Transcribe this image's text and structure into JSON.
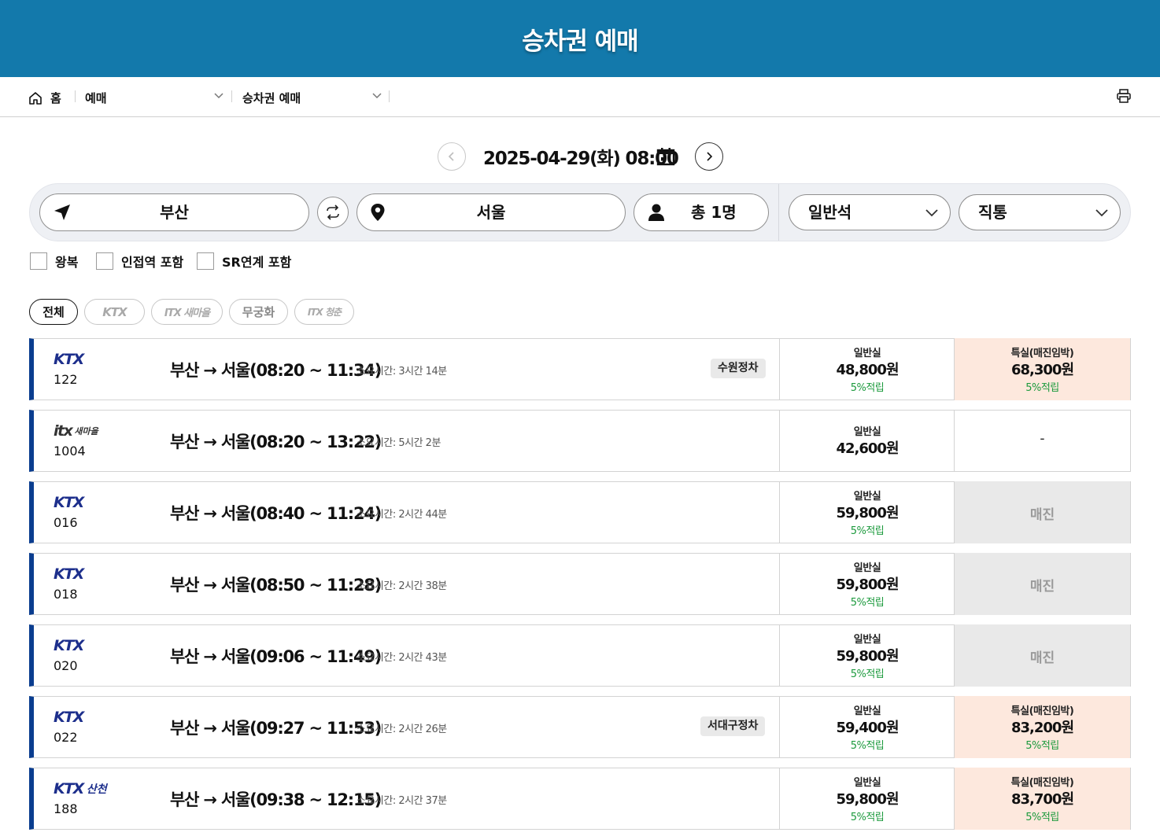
{
  "header": {
    "title": "승차권 예매"
  },
  "breadcrumb": {
    "home": "홈",
    "level1": "예매",
    "level2": "승차권 예매"
  },
  "date": {
    "text": "2025-04-29(화) 08:00"
  },
  "search": {
    "departure": "부산",
    "arrival": "서울",
    "passengers": "총 1명",
    "seat_class": "일반석",
    "route_type": "직통"
  },
  "options": [
    "왕복",
    "인접역 포함",
    "SR연계 포함"
  ],
  "filters": [
    "전체",
    "KTX",
    "ITX 새마을",
    "무궁화",
    "ITX 청춘"
  ],
  "trains": [
    {
      "logo": "KTX",
      "number": "122",
      "route": "부산 → 서울(08:20 ~ 11:34)",
      "duration": "소요시간: 3시간 14분",
      "badge": "수원정차",
      "general": {
        "title": "일반실",
        "price": "48,800원",
        "points": "5%적립"
      },
      "special": {
        "state": "available",
        "title": "특실(매진임박)",
        "price": "68,300원",
        "points": "5%적립"
      }
    },
    {
      "logo": "ITX-SAEMAEUL",
      "number": "1004",
      "route": "부산 → 서울(08:20 ~ 13:22)",
      "duration": "소요시간: 5시간 2분",
      "badge": "",
      "general": {
        "title": "일반실",
        "price": "42,600원",
        "points": ""
      },
      "special": {
        "state": "none",
        "text": "-"
      }
    },
    {
      "logo": "KTX",
      "number": "016",
      "route": "부산 → 서울(08:40 ~ 11:24)",
      "duration": "소요시간: 2시간 44분",
      "badge": "",
      "general": {
        "title": "일반실",
        "price": "59,800원",
        "points": "5%적립"
      },
      "special": {
        "state": "soldout",
        "text": "매진"
      }
    },
    {
      "logo": "KTX",
      "number": "018",
      "route": "부산 → 서울(08:50 ~ 11:28)",
      "duration": "소요시간: 2시간 38분",
      "badge": "",
      "general": {
        "title": "일반실",
        "price": "59,800원",
        "points": "5%적립"
      },
      "special": {
        "state": "soldout",
        "text": "매진"
      }
    },
    {
      "logo": "KTX",
      "number": "020",
      "route": "부산 → 서울(09:06 ~ 11:49)",
      "duration": "소요시간: 2시간 43분",
      "badge": "",
      "general": {
        "title": "일반실",
        "price": "59,800원",
        "points": "5%적립"
      },
      "special": {
        "state": "soldout",
        "text": "매진"
      }
    },
    {
      "logo": "KTX",
      "number": "022",
      "route": "부산 → 서울(09:27 ~ 11:53)",
      "duration": "소요시간: 2시간 26분",
      "badge": "서대구정차",
      "general": {
        "title": "일반실",
        "price": "59,400원",
        "points": "5%적립"
      },
      "special": {
        "state": "available",
        "title": "특실(매진임박)",
        "price": "83,200원",
        "points": "5%적립"
      }
    },
    {
      "logo": "KTX-SANCHEON",
      "number": "188",
      "route": "부산 → 서울(09:38 ~ 12:15)",
      "duration": "소요시간: 2시간 37분",
      "badge": "",
      "general": {
        "title": "일반실",
        "price": "59,800원",
        "points": "5%적립"
      },
      "special": {
        "state": "available",
        "title": "특실(매진임박)",
        "price": "83,700원",
        "points": "5%적립"
      }
    }
  ],
  "colors": {
    "header": "#1379ab",
    "accent_bar": "#0a3d8f",
    "points_green": "#1c9a3d",
    "sale_bg": "#fde8dd",
    "soldout_bg": "#e9e9e9"
  },
  "icons": [
    "home-icon",
    "chevron-down-icon",
    "print-icon",
    "chevron-left-icon",
    "chevron-right-icon",
    "calendar-icon",
    "navigation-arrow-icon",
    "swap-icon",
    "map-pin-icon",
    "person-icon"
  ]
}
